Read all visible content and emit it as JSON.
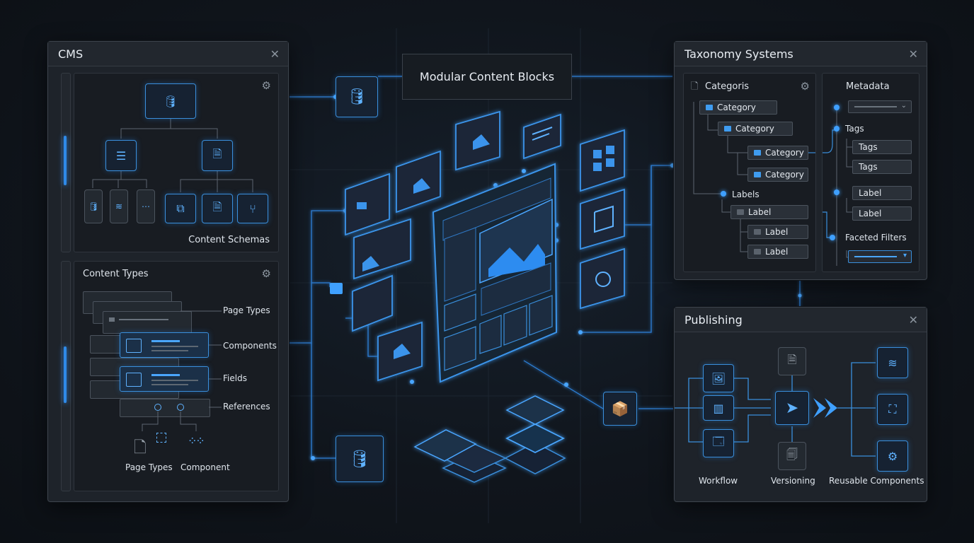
{
  "center": {
    "title": "Modular Content Blocks"
  },
  "cms": {
    "title": "CMS",
    "schemas_label": "Content Schemas",
    "types_title": "Content Types",
    "type_labels": [
      "Page Types",
      "Components",
      "Fields",
      "References"
    ],
    "bottom_labels": [
      "Page Types",
      "Component"
    ]
  },
  "taxonomy": {
    "title": "Taxonomy Systems",
    "categories_header": "Categoris",
    "metadata_header": "Metadata",
    "categories": [
      "Category",
      "Category",
      "Category",
      "Category"
    ],
    "labels_header": "Labels",
    "labels": [
      "Label",
      "Label",
      "Label"
    ],
    "tags_header": "Tags",
    "tags": [
      "Tags",
      "Tags"
    ],
    "meta_labels": [
      "Label",
      "Label"
    ],
    "faceted_filters": "Faceted Filters"
  },
  "publishing": {
    "title": "Publishing",
    "workflow": "Workflow",
    "versioning": "Versioning",
    "reusable_components": "Reusable Components"
  },
  "icons": {
    "close": "close-icon",
    "gear": "gear-icon",
    "database": "database-icon",
    "document": "document-icon",
    "list": "list-icon",
    "layers": "layers-icon",
    "hierarchy": "hierarchy-icon",
    "image": "image-icon",
    "grid": "grid-icon",
    "window": "window-icon",
    "package": "package-icon",
    "arrow-right": "arrow-right-icon"
  },
  "colors": {
    "accent": "#3a9cff",
    "background": "#10151c",
    "panel": "#1e232a"
  }
}
